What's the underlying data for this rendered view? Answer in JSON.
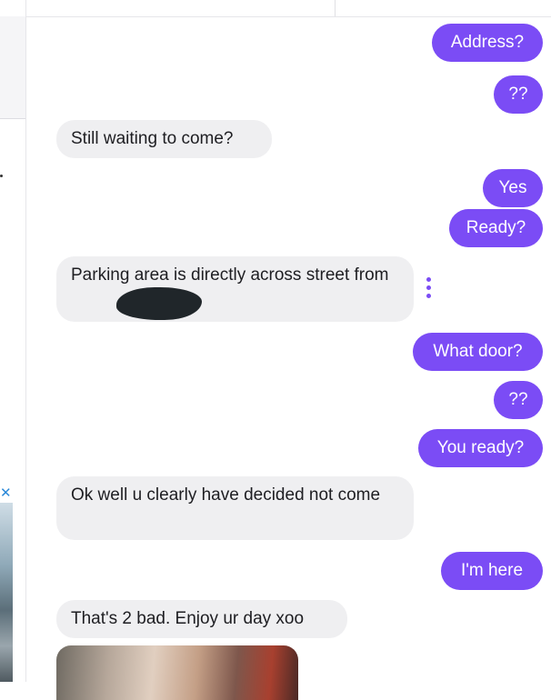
{
  "conversation": {
    "messages": [
      {
        "side": "out",
        "text": "Address?"
      },
      {
        "side": "out",
        "text": "??"
      },
      {
        "side": "in",
        "text": "Still waiting to come?"
      },
      {
        "side": "out",
        "text": "Yes"
      },
      {
        "side": "out",
        "text": "Ready?"
      },
      {
        "side": "in",
        "text": "Parking area is directly across street from",
        "redacted": true
      },
      {
        "side": "out",
        "text": "What door?"
      },
      {
        "side": "out",
        "text": "??"
      },
      {
        "side": "out",
        "text": "You ready?"
      },
      {
        "side": "in",
        "text": "Ok well u clearly have decided not come"
      },
      {
        "side": "out",
        "text": "I'm here"
      },
      {
        "side": "in",
        "text": "That's 2 bad. Enjoy ur day xoo"
      },
      {
        "side": "in",
        "type": "image"
      }
    ]
  },
  "ad": {
    "close_glyph": "✕"
  },
  "icons": {
    "message_options": "more-vertical-icon",
    "ad_close": "close-icon"
  },
  "colors": {
    "outgoing_bubble": "#7b4cf5",
    "incoming_bubble": "#efeff1",
    "accent": "#7b4cf5"
  }
}
